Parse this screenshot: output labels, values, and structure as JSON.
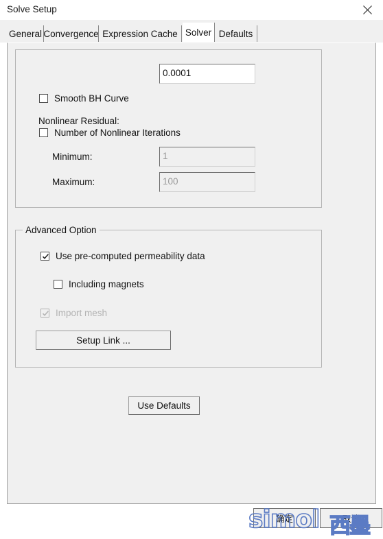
{
  "window": {
    "title": "Solve Setup",
    "close_icon": "close-icon"
  },
  "tabs": [
    {
      "label": "General",
      "selected": false
    },
    {
      "label": "Convergence",
      "selected": false
    },
    {
      "label": "Expression Cache",
      "selected": false
    },
    {
      "label": "Solver",
      "selected": true
    },
    {
      "label": "Defaults",
      "selected": false
    }
  ],
  "solver_panel": {
    "nonlinear_residual": {
      "label": "Nonlinear Residual:",
      "value": "0.0001"
    },
    "smooth_bh_curve": {
      "label": "Smooth BH Curve",
      "checked": false,
      "enabled": true
    },
    "number_of_nonlinear_iterations": {
      "label": "Number of Nonlinear Iterations",
      "checked": false,
      "enabled": true
    },
    "minimum": {
      "label": "Minimum:",
      "value": "1",
      "enabled": false
    },
    "maximum": {
      "label": "Maximum:",
      "value": "100",
      "enabled": false
    }
  },
  "advanced_option": {
    "title": "Advanced Option",
    "use_precomputed_permeability": {
      "label": "Use pre-computed permeability data",
      "checked": true,
      "enabled": true
    },
    "including_magnets": {
      "label": "Including magnets",
      "checked": false,
      "enabled": true
    },
    "import_mesh": {
      "label": "Import mesh",
      "checked": true,
      "enabled": false
    },
    "setup_link_button": "Setup Link ..."
  },
  "use_defaults_button": "Use Defaults",
  "dialog_buttons": {
    "ok": "确定",
    "cancel": "取消"
  },
  "watermark": {
    "latin": "simol",
    "cjk": "西墨",
    "color": "#5b7bc4"
  },
  "colors": {
    "dialog_background": "#f0f0f0",
    "titlebar_background": "#ffffff",
    "field_background": "#ffffff",
    "disabled_text": "#9a9a9a",
    "border": "#b4b4b4"
  }
}
